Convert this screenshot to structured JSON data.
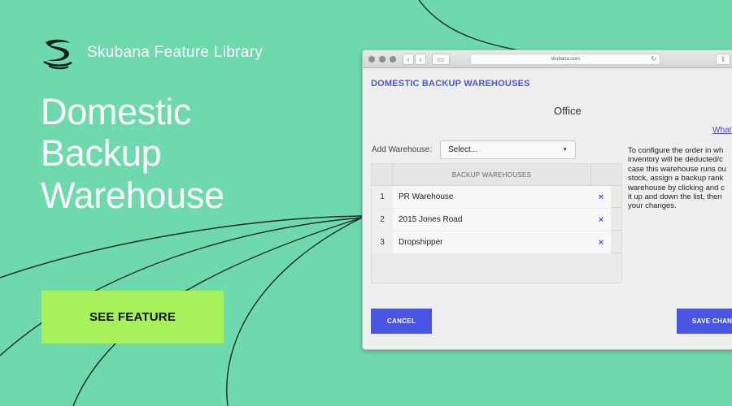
{
  "brand": {
    "name": "Skubana Feature Library"
  },
  "hero": {
    "title": "Domestic Backup Warehouse",
    "cta_label": "SEE FEATURE"
  },
  "colors": {
    "background": "#6fd9ae",
    "cta": "#a7f25b",
    "accent": "#4a55e6"
  },
  "browser": {
    "url": "skubana.com",
    "page": {
      "heading": "DOMESTIC BACKUP WAREHOUSES",
      "warehouse_name": "Office",
      "help_link": "What",
      "add_label": "Add Warehouse:",
      "select_value": "Select...",
      "table": {
        "header": "BACKUP WAREHOUSES",
        "rows": [
          {
            "num": "1",
            "name": "PR Warehouse"
          },
          {
            "num": "2",
            "name": "2015 Jones Road"
          },
          {
            "num": "3",
            "name": "Dropshipper"
          }
        ],
        "remove_icon": "×"
      },
      "instructions": "To configure the order in wh\ninventory will be deducted/c\ncase this warehouse runs ou\nstock, assign a backup rank\nwarehouse by clicking and c\nit up and down the list, then\nyour changes.",
      "cancel_label": "CANCEL",
      "save_label": "SAVE CHAN"
    }
  }
}
